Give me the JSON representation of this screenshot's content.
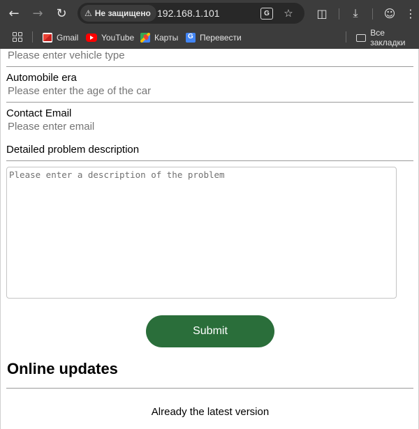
{
  "browser": {
    "security_label": "Не защищено",
    "url": "192.168.1.101",
    "translate_glyph": "G",
    "bookmarks": [
      {
        "label": "Gmail"
      },
      {
        "label": "YouTube"
      },
      {
        "label": "Карты"
      },
      {
        "label": "Перевести"
      }
    ],
    "all_bookmarks_label": "Все закладки"
  },
  "form": {
    "vehicle_type": {
      "placeholder": "Please enter vehicle type"
    },
    "automobile_era": {
      "label": "Automobile era",
      "placeholder": "Please enter the age of the car"
    },
    "contact_email": {
      "label": "Contact Email",
      "placeholder": "Please enter email"
    },
    "problem_description": {
      "label": "Detailed problem description",
      "placeholder": "Please enter a description of the problem"
    },
    "submit_label": "Submit"
  },
  "updates": {
    "title": "Online updates",
    "status": "Already the latest version"
  },
  "colors": {
    "accent": "#2a6e3a",
    "chrome_bg": "#3c3c3c"
  }
}
